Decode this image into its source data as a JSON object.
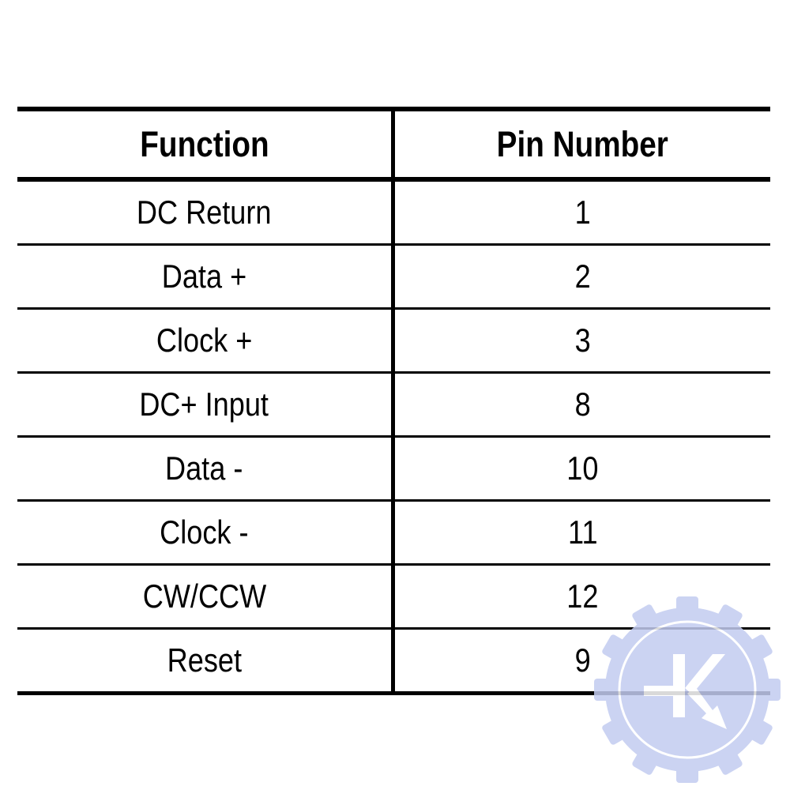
{
  "table": {
    "headers": [
      "Function",
      "Pin Number"
    ],
    "rows": [
      [
        "DC Return",
        "1"
      ],
      [
        "Data +",
        "2"
      ],
      [
        "Clock +",
        "3"
      ],
      [
        "DC+ Input",
        "8"
      ],
      [
        "Data -",
        "10"
      ],
      [
        "Clock -",
        "11"
      ],
      [
        "CW/CCW",
        "12"
      ],
      [
        "Reset",
        "9"
      ]
    ]
  },
  "watermark": {
    "icon": "gear-k-logo-icon",
    "color": "#c3ccf0"
  }
}
